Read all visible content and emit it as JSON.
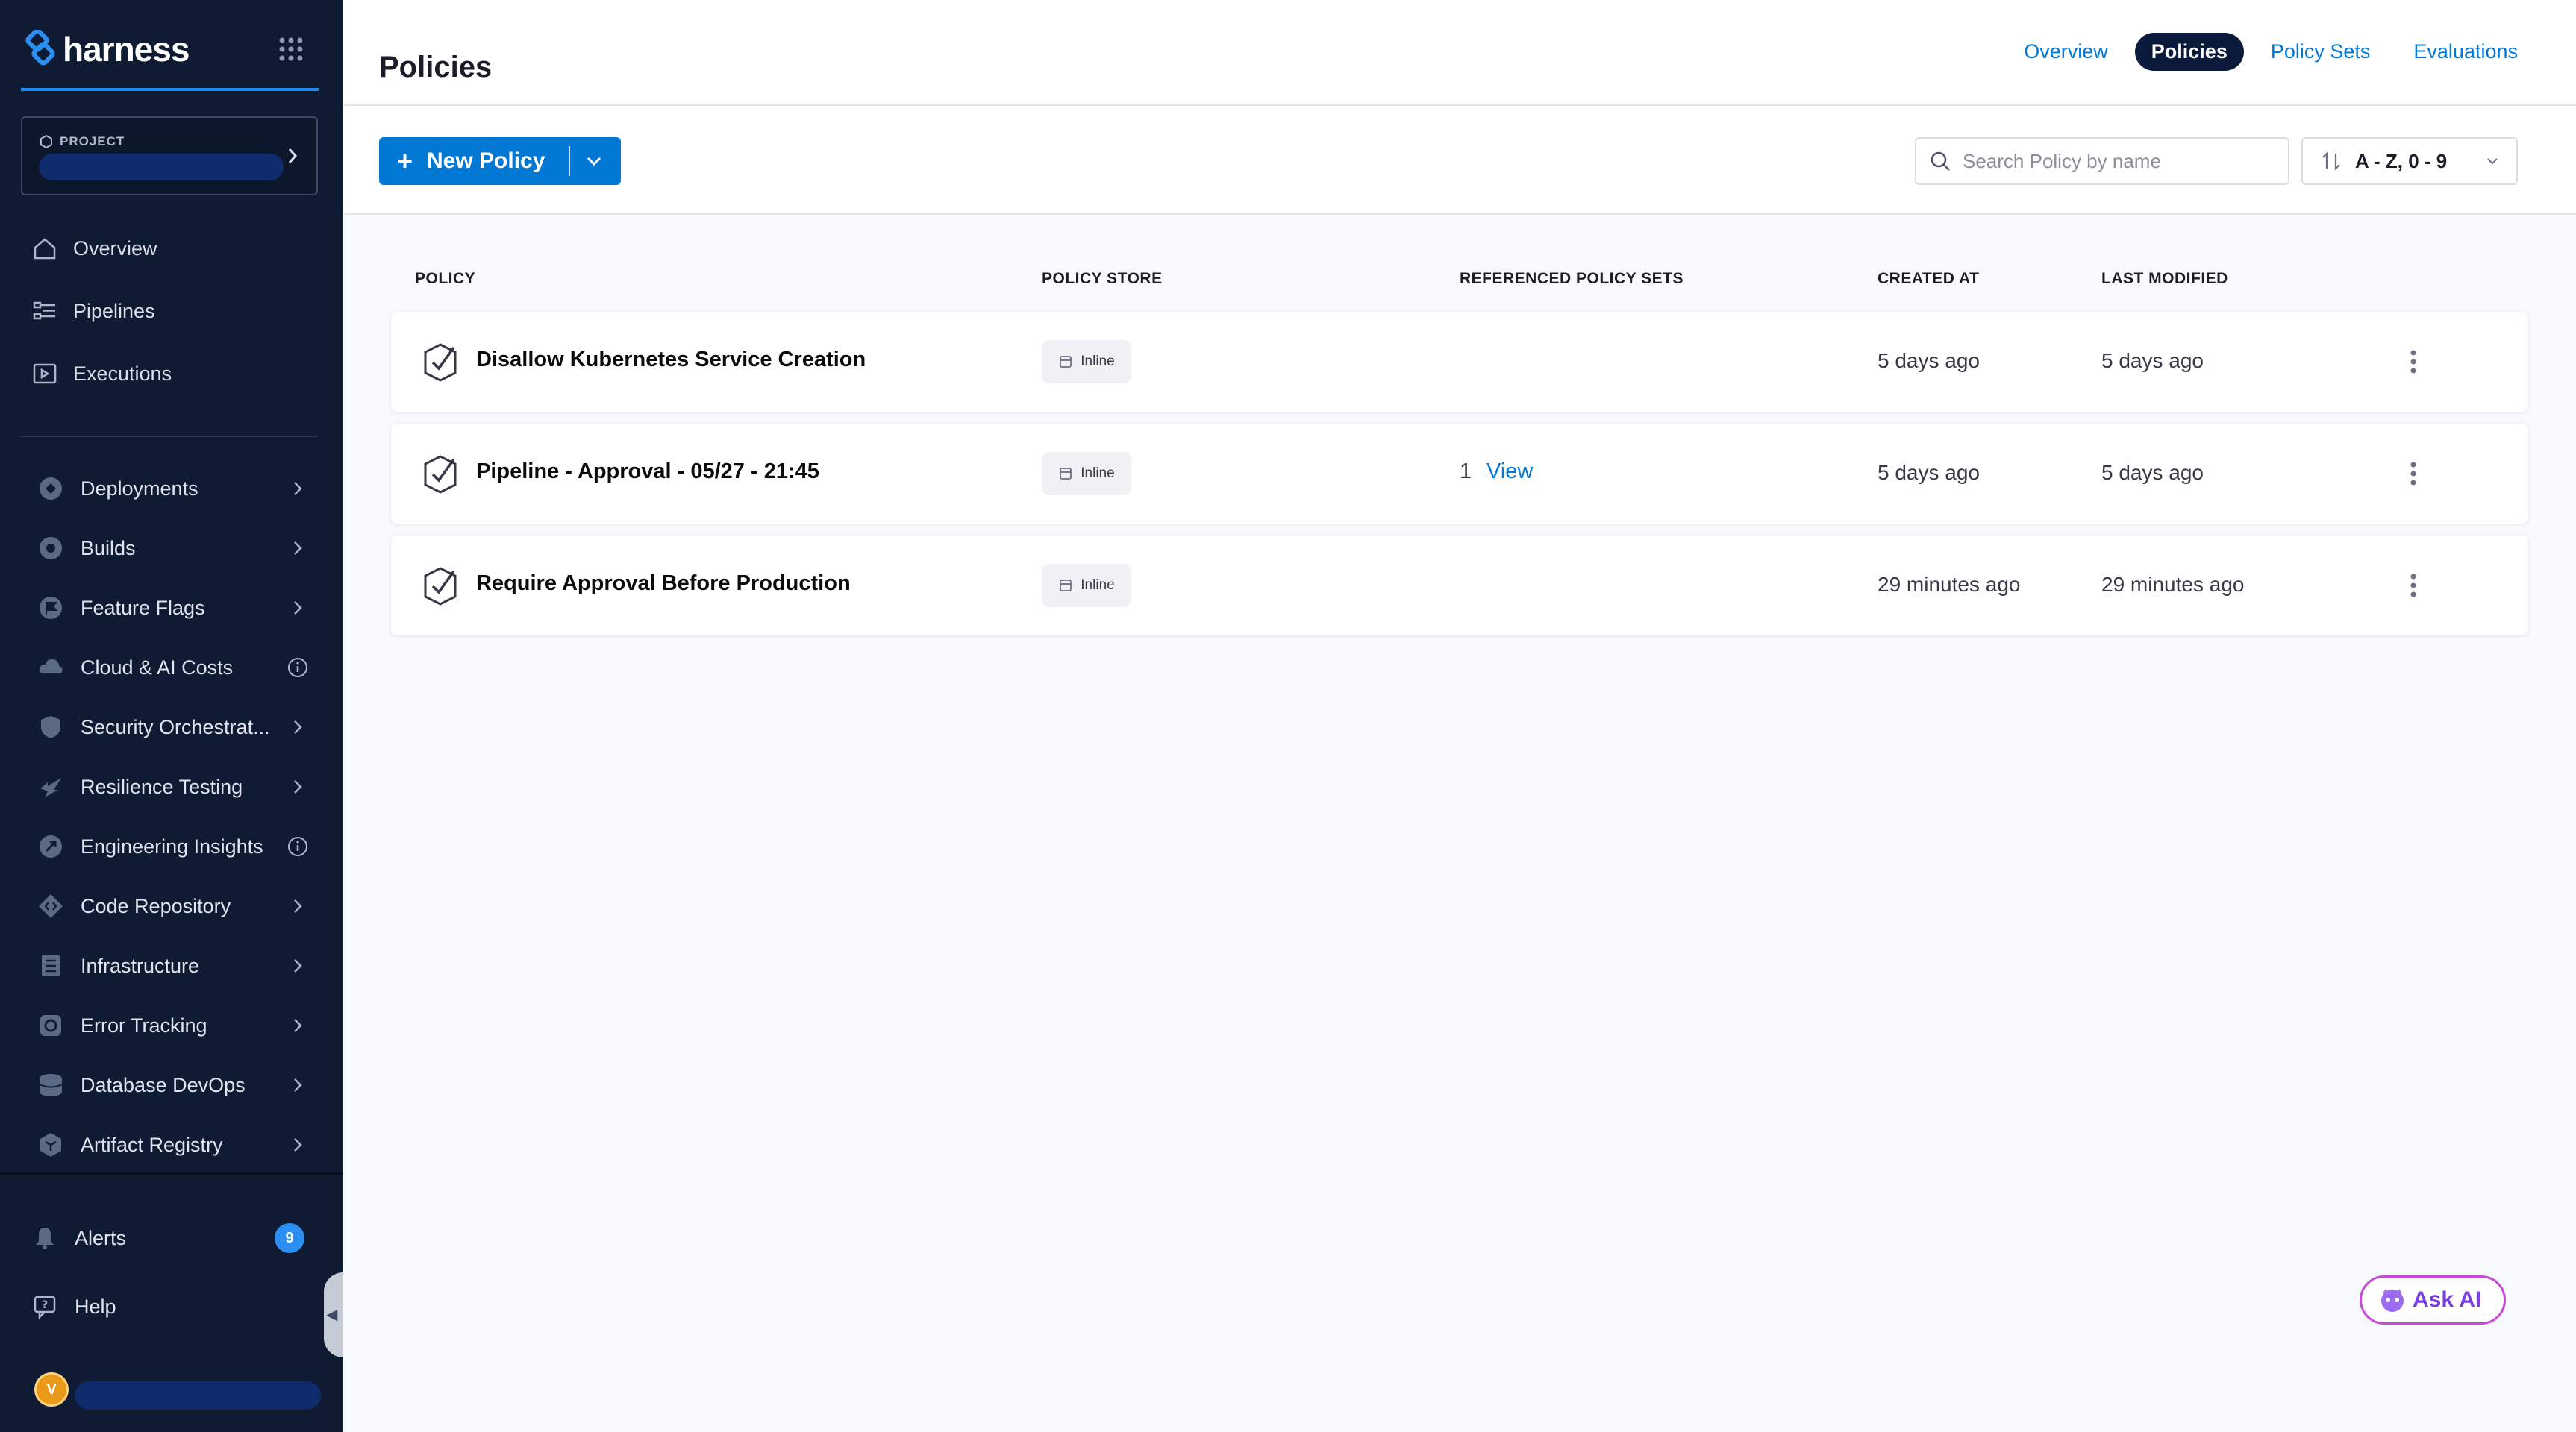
{
  "sidebar": {
    "brand": "harness",
    "project_label": "PROJECT",
    "top_nav": [
      {
        "label": "Overview",
        "icon": "home-icon"
      },
      {
        "label": "Pipelines",
        "icon": "pipelines-icon"
      },
      {
        "label": "Executions",
        "icon": "executions-icon"
      }
    ],
    "modules": [
      {
        "label": "Deployments",
        "trail": "chevron"
      },
      {
        "label": "Builds",
        "trail": "chevron"
      },
      {
        "label": "Feature Flags",
        "trail": "chevron"
      },
      {
        "label": "Cloud & AI Costs",
        "trail": "info"
      },
      {
        "label": "Security Orchestrat...",
        "trail": "chevron"
      },
      {
        "label": "Resilience Testing",
        "trail": "chevron"
      },
      {
        "label": "Engineering Insights",
        "trail": "info"
      },
      {
        "label": "Code Repository",
        "trail": "chevron"
      },
      {
        "label": "Infrastructure",
        "trail": "chevron"
      },
      {
        "label": "Error Tracking",
        "trail": "chevron"
      },
      {
        "label": "Database DevOps",
        "trail": "chevron"
      },
      {
        "label": "Artifact Registry",
        "trail": "chevron"
      }
    ],
    "alerts_label": "Alerts",
    "alerts_count": "9",
    "help_label": "Help",
    "avatar_initial": "V"
  },
  "header": {
    "title": "Policies",
    "tabs": [
      {
        "label": "Overview",
        "active": false
      },
      {
        "label": "Policies",
        "active": true
      },
      {
        "label": "Policy Sets",
        "active": false
      },
      {
        "label": "Evaluations",
        "active": false
      }
    ]
  },
  "toolbar": {
    "new_policy_label": "New Policy",
    "search_placeholder": "Search Policy by name",
    "sort_label": "A - Z, 0 - 9"
  },
  "table": {
    "columns": [
      "POLICY",
      "POLICY STORE",
      "REFERENCED POLICY SETS",
      "CREATED AT",
      "LAST MODIFIED"
    ],
    "rows": [
      {
        "name": "Disallow Kubernetes Service Creation",
        "store": "Inline",
        "ref_count": "",
        "ref_link": "",
        "created": "5 days ago",
        "modified": "5 days ago"
      },
      {
        "name": "Pipeline - Approval - 05/27 - 21:45",
        "store": "Inline",
        "ref_count": "1",
        "ref_link": "View",
        "created": "5 days ago",
        "modified": "5 days ago"
      },
      {
        "name": "Require Approval Before Production",
        "store": "Inline",
        "ref_count": "",
        "ref_link": "",
        "created": "29 minutes ago",
        "modified": "29 minutes ago"
      }
    ]
  },
  "ask_ai_label": "Ask AI",
  "colors": {
    "sidebar_bg": "#0e1b33",
    "accent": "#0278d5",
    "active_tab": "#0a1a3b",
    "badge": "#2a8ff0"
  }
}
